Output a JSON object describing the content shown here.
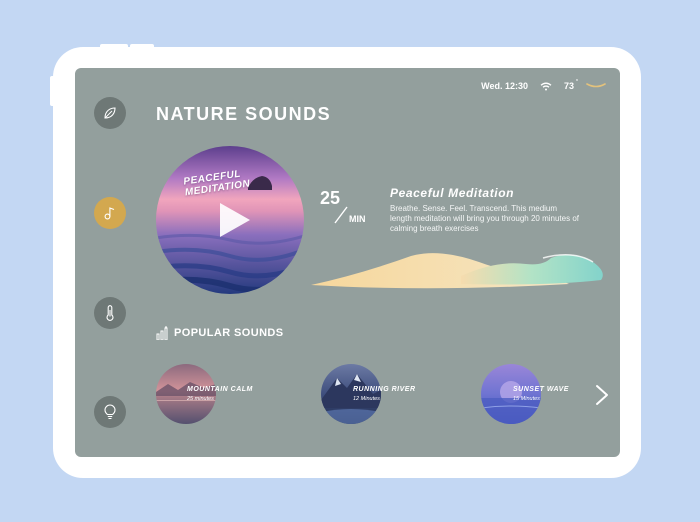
{
  "status": {
    "datetime": "Wed. 12:30",
    "temperature": "73",
    "wifi_icon": "wifi-icon",
    "battery_icon": "battery-icon"
  },
  "sidebar": {
    "items": [
      {
        "icon": "leaf-icon"
      },
      {
        "icon": "music-note-icon",
        "active": true
      },
      {
        "icon": "thermometer-icon"
      },
      {
        "icon": "lightbulb-icon"
      }
    ]
  },
  "page": {
    "title": "NATURE SOUNDS"
  },
  "featured": {
    "image_label_line1": "PEACEFUL",
    "image_label_line2": "MEDITATION",
    "duration_value": "25",
    "duration_unit": "MIN",
    "title": "Peaceful Meditation",
    "description": "Breathe. Sense. Feel. Transcend. This medium length meditation will bring you through 20 minutes of calming breath exercises"
  },
  "popular": {
    "heading": "POPULAR SOUNDS",
    "items": [
      {
        "title": "MOUNTAIN CALM",
        "duration": "25 minutes"
      },
      {
        "title": "RUNNING RIVER",
        "duration": "12 Minutes"
      },
      {
        "title": "SUNSET WAVE",
        "duration": "15 Minutes"
      }
    ]
  },
  "colors": {
    "screen_bg": "#939f9d",
    "accent_gold": "#d3a84f",
    "page_bg": "#c3d7f3"
  }
}
